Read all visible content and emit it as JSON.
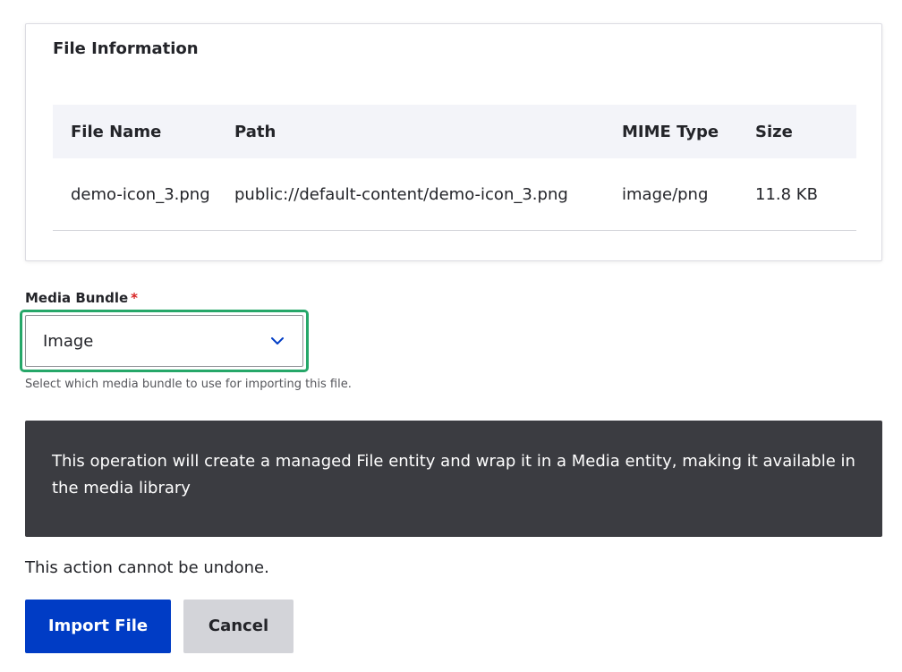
{
  "file_info": {
    "title": "File Information",
    "columns": [
      "File Name",
      "Path",
      "MIME Type",
      "Size"
    ],
    "rows": [
      {
        "file_name": "demo-icon_3.png",
        "path": "public://default-content/demo-icon_3.png",
        "mime_type": "image/png",
        "size": "11.8 KB"
      }
    ]
  },
  "media_bundle": {
    "label": "Media Bundle",
    "required_marker": "*",
    "selected_value": "Image",
    "help_text": "Select which media bundle to use for importing this file.",
    "icon": "chevron-down-icon"
  },
  "notice": {
    "text": "This operation will create a managed File entity and wrap it in a Media entity, making it available in the media library"
  },
  "warning": {
    "text": "This action cannot be undone."
  },
  "actions": {
    "import_label": "Import File",
    "cancel_label": "Cancel"
  },
  "colors": {
    "primary_button": "#003cc5",
    "secondary_button": "#d3d4d9",
    "focus_ring": "#26a769",
    "notice_background": "#3b3c41",
    "required_marker": "#d72222",
    "chevron": "#003cc5"
  }
}
